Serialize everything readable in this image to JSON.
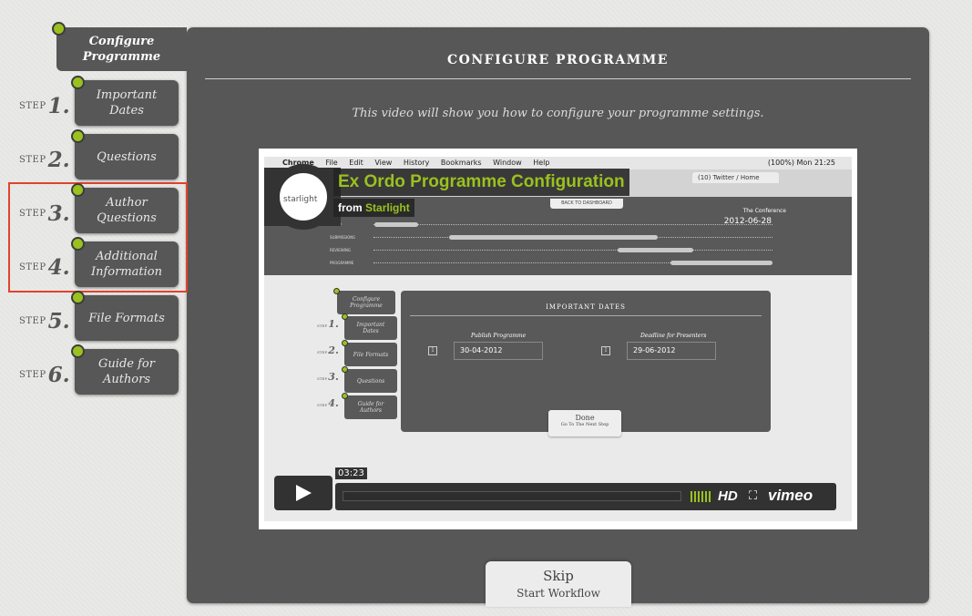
{
  "sidebar": {
    "configure_tab": "Configure\nProgramme",
    "step_word": "STEP",
    "steps": [
      {
        "num": "1.",
        "label": "Important\nDates"
      },
      {
        "num": "2.",
        "label": "Questions"
      },
      {
        "num": "3.",
        "label": "Author\nQuestions"
      },
      {
        "num": "4.",
        "label": "Additional\nInformation"
      },
      {
        "num": "5.",
        "label": "File Formats"
      },
      {
        "num": "6.",
        "label": "Guide for\nAuthors"
      }
    ]
  },
  "main": {
    "title": "CONFIGURE PROGRAMME",
    "description": "This video will show you how to configure your programme settings."
  },
  "video": {
    "title": "Ex Ordo Programme Configuration",
    "from_label": "from",
    "from_author": "Starlight",
    "logo_text": "starlight",
    "timecode": "03:23",
    "hd_label": "HD",
    "fullscreen_icon": "⛶",
    "brand": "vimeo",
    "screen": {
      "menubar": [
        "Chrome",
        "File",
        "Edit",
        "View",
        "History",
        "Bookmarks",
        "Window",
        "Help"
      ],
      "clock": "(100%) Mon 21:25",
      "browser_tab": "(10) Twitter / Home",
      "back_button": "BACK TO DASHBOARD",
      "conference_name": "The Conference",
      "conference_date": "2012-06-28",
      "progress_rows": [
        {
          "label": "SETUP",
          "fill_start": 0.02,
          "fill_end": 0.12
        },
        {
          "label": "SUBMISSIONS",
          "fill_start": 0.19,
          "fill_end": 0.72
        },
        {
          "label": "REVIEWING",
          "fill_start": 0.62,
          "fill_end": 0.79
        },
        {
          "label": "PROGRAMME",
          "fill_start": 0.74,
          "fill_end": 1.0
        }
      ],
      "panel_title": "IMPORTANT DATES",
      "publish_label": "Publish Programme",
      "publish_value": "30-04-2012",
      "deadline_label": "Deadline for Presenters",
      "deadline_value": "29-06-2012",
      "done_label": "Done",
      "done_sub": "Go To The Next Step",
      "mini_configure": "Configure\nProgramme",
      "mini_steps": [
        {
          "num": "1.",
          "label": "Important\nDates"
        },
        {
          "num": "2.",
          "label": "File Formats"
        },
        {
          "num": "3.",
          "label": "Questions"
        },
        {
          "num": "4.",
          "label": "Guide for\nAuthors"
        }
      ]
    }
  },
  "skip": {
    "label": "Skip",
    "sublabel": "Start Workflow"
  },
  "colors": {
    "panel": "#575757",
    "accent_green": "#9ac11e",
    "highlight_red": "#e0432c",
    "background": "#e9e9e7"
  }
}
